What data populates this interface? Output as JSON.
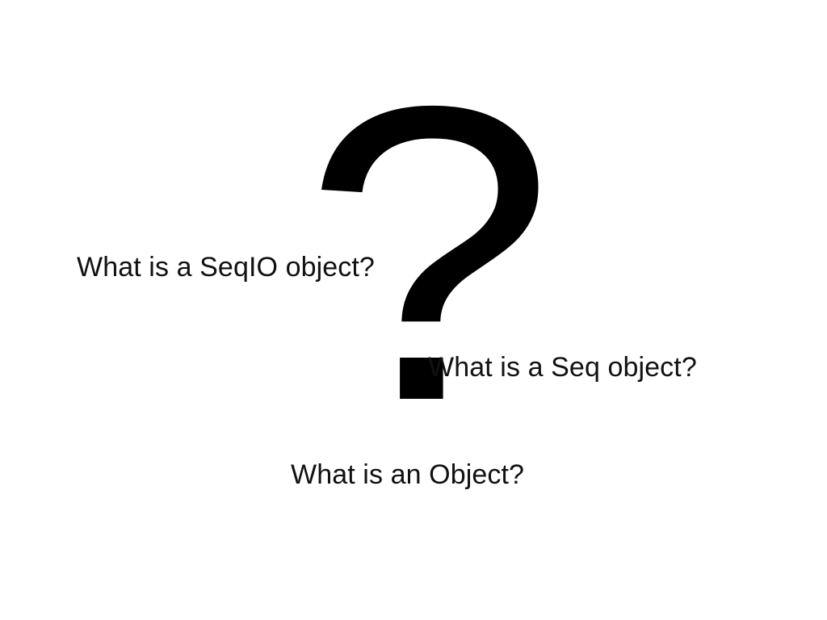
{
  "slide": {
    "background": "#ffffff",
    "text_color": "#000000",
    "symbol": "?",
    "questions": {
      "seqio": "What is a SeqIO object?",
      "seq": "What is a Seq object?",
      "object": "What is an Object?"
    }
  }
}
